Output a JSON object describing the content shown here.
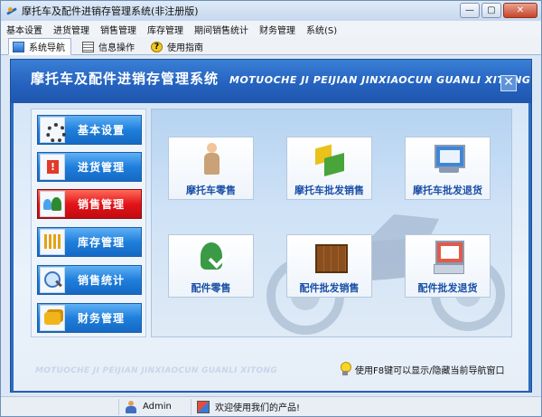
{
  "window": {
    "title": "摩托车及配件进销存管理系统(非注册版)"
  },
  "menu": [
    "基本设置",
    "进货管理",
    "销售管理",
    "库存管理",
    "期间销售统计",
    "财务管理",
    "系统(S)"
  ],
  "tabs": [
    {
      "label": "系统导航",
      "icon": "nav-icon",
      "active": true
    },
    {
      "label": "信息操作",
      "icon": "info-icon",
      "active": false
    },
    {
      "label": "使用指南",
      "icon": "help-icon",
      "active": false
    }
  ],
  "banner": {
    "title": "摩托车及配件进销存管理系统",
    "subtitle": "MOTUOCHE JI PEIJIAN JINXIAOCUN GUANLI XITONG"
  },
  "left_nav": [
    {
      "label": "基本设置",
      "icon": "gear-icon",
      "active": false
    },
    {
      "label": "进货管理",
      "icon": "warning-icon",
      "active": false
    },
    {
      "label": "销售管理",
      "icon": "users-icon",
      "active": true
    },
    {
      "label": "库存管理",
      "icon": "stock-icon",
      "active": false
    },
    {
      "label": "销售统计",
      "icon": "chart-icon",
      "active": false
    },
    {
      "label": "财务管理",
      "icon": "money-icon",
      "active": false
    }
  ],
  "tiles": [
    {
      "label": "摩托车零售",
      "icon": "person-icon"
    },
    {
      "label": "摩托车批发销售",
      "icon": "cubes-icon"
    },
    {
      "label": "摩托车批发退货",
      "icon": "monitor-icon"
    },
    {
      "label": "配件零售",
      "icon": "user-check-icon"
    },
    {
      "label": "配件批发销售",
      "icon": "box-icon"
    },
    {
      "label": "配件批发退货",
      "icon": "pos-icon"
    }
  ],
  "footer": {
    "subtitle": "MOTUOCHE JI PEIJIAN JINXIAOCUN GUANLI XITONG",
    "hint": "使用F8键可以显示/隐藏当前导航窗口"
  },
  "status": {
    "user": "Admin",
    "welcome": "欢迎使用我们的产品!"
  },
  "colors": {
    "accent_blue": "#1f7fdc",
    "active_red": "#e3141a",
    "banner_blue": "#2563bf"
  }
}
